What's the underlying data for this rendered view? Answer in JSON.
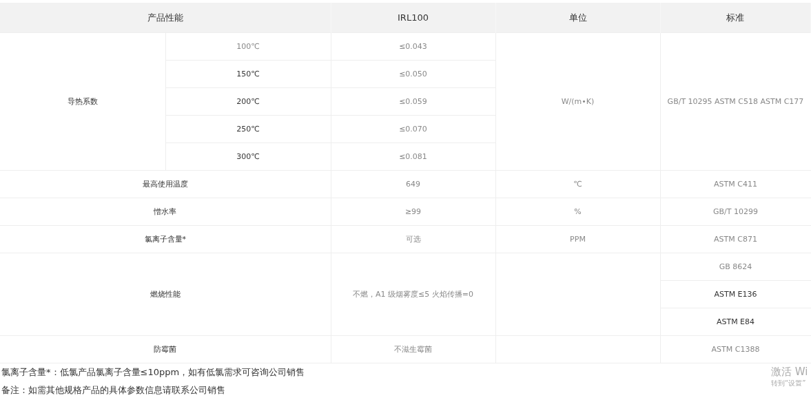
{
  "table": {
    "columns": [
      "产品性能",
      "IRL100",
      "单位",
      "标准"
    ],
    "thermal": {
      "label": "导热系数",
      "unit": "W/(m•K)",
      "standard": "GB/T 10295 ASTM C518 ASTM C177",
      "rows": [
        {
          "temp": "100℃",
          "value": "≤0.043",
          "dark": false
        },
        {
          "temp": "150℃",
          "value": "≤0.050",
          "dark": true
        },
        {
          "temp": "200℃",
          "value": "≤0.059",
          "dark": true
        },
        {
          "temp": "250℃",
          "value": "≤0.070",
          "dark": true
        },
        {
          "temp": "300℃",
          "value": "≤0.081",
          "dark": true
        }
      ]
    },
    "rows": [
      {
        "label": "最高使用温度",
        "value": "649",
        "unit": "℃",
        "standards": [
          {
            "text": "ASTM C411",
            "dark": false
          }
        ]
      },
      {
        "label": "憎水率",
        "value": "≥99",
        "unit": "%",
        "standards": [
          {
            "text": "GB/T 10299",
            "dark": false
          }
        ]
      },
      {
        "label": "氯离子含量*",
        "value": "可选",
        "unit": "PPM",
        "standards": [
          {
            "text": "ASTM C871",
            "dark": false
          }
        ]
      },
      {
        "label": "燃烧性能",
        "value": "不燃，A1 级烟雾度≤5 火焰传播=0",
        "standards": [
          {
            "text": "GB 8624",
            "dark": false
          },
          {
            "text": "ASTM E136",
            "dark": true
          },
          {
            "text": "ASTM E84",
            "dark": true
          }
        ]
      },
      {
        "label": "防霉菌",
        "value": "不滋生霉菌",
        "standards": [
          {
            "text": "ASTM C1388",
            "dark": false
          }
        ]
      }
    ]
  },
  "notes": [
    "氯离子含量*：低氯产品氯离子含量≤10ppm，如有低氯需求可咨询公司销售",
    "备注：如需其他规格产品的具体参数信息请联系公司销售"
  ],
  "os_notice": {
    "title": "激活 Wi",
    "subtitle": "转到“设置”"
  }
}
